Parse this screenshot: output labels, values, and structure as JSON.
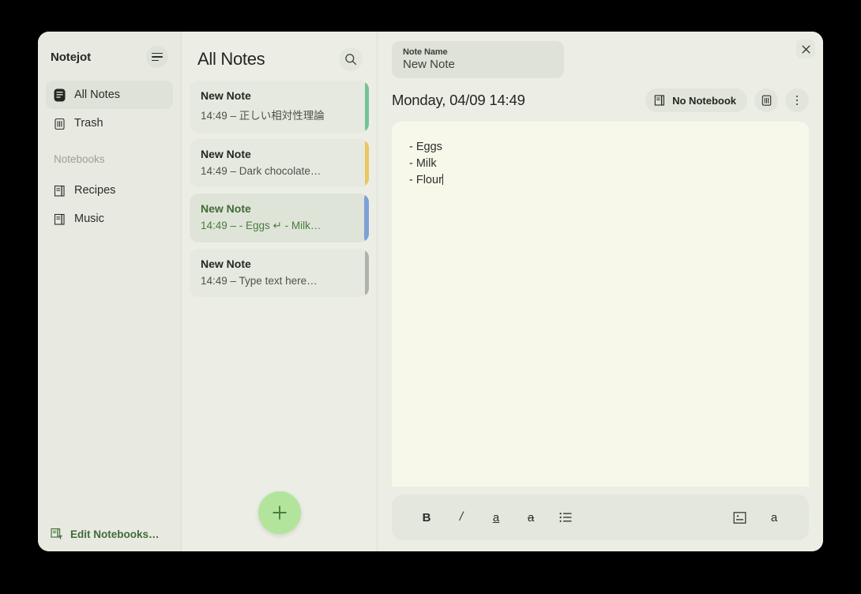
{
  "window": {
    "close_label": "×"
  },
  "sidebar": {
    "app_title": "Notejot",
    "menu_icon": "hamburger-icon",
    "items": [
      {
        "label": "All Notes",
        "icon": "note-icon",
        "active": true
      },
      {
        "label": "Trash",
        "icon": "trash-icon",
        "active": false
      }
    ],
    "notebooks_section_label": "Notebooks",
    "notebooks": [
      {
        "label": "Recipes",
        "icon": "notebook-icon"
      },
      {
        "label": "Music",
        "icon": "notebook-icon"
      }
    ],
    "edit_notebooks_label": "Edit Notebooks…",
    "edit_notebooks_icon": "notebook-edit-icon",
    "edit_notebooks_color": "#3f6b36"
  },
  "notes_panel": {
    "title": "All Notes",
    "search_icon": "search-icon",
    "add_button_icon": "plus-icon",
    "add_button_color": "#b2e59b",
    "notes": [
      {
        "name": "New Note",
        "snippet": "14:49 – 正しい相対性理論",
        "accent": "#74c295",
        "selected": false
      },
      {
        "name": "New Note",
        "snippet": "14:49 – Dark chocolate…",
        "accent": "#ebc661",
        "selected": false
      },
      {
        "name": "New Note",
        "snippet": "14:49 – - Eggs ↵ - Milk…",
        "accent": "#7fa0d6",
        "selected": true
      },
      {
        "name": "New Note",
        "snippet": "14:49 – Type text here…",
        "accent": "#aeb2aa",
        "selected": false
      }
    ]
  },
  "editor": {
    "name_field": {
      "label": "Note Name",
      "value": "New Note",
      "placeholder": "Note Name"
    },
    "date": "Monday, 04/09 14:49",
    "notebook_button": {
      "label": "No Notebook",
      "icon": "notebook-icon"
    },
    "trash_button_icon": "trash-icon",
    "more_button_icon": "more-vertical-icon",
    "content_lines": [
      "- Eggs",
      "- Milk",
      "- Flour"
    ],
    "toolbar": [
      {
        "name": "bold",
        "glyph": "B"
      },
      {
        "name": "italic",
        "glyph": "/"
      },
      {
        "name": "underline",
        "glyph": "a"
      },
      {
        "name": "strikethrough",
        "glyph": "a"
      },
      {
        "name": "bullet-list",
        "glyph": ""
      },
      {
        "name": "insert-image",
        "glyph": ""
      },
      {
        "name": "font-style",
        "glyph": "a"
      }
    ]
  }
}
